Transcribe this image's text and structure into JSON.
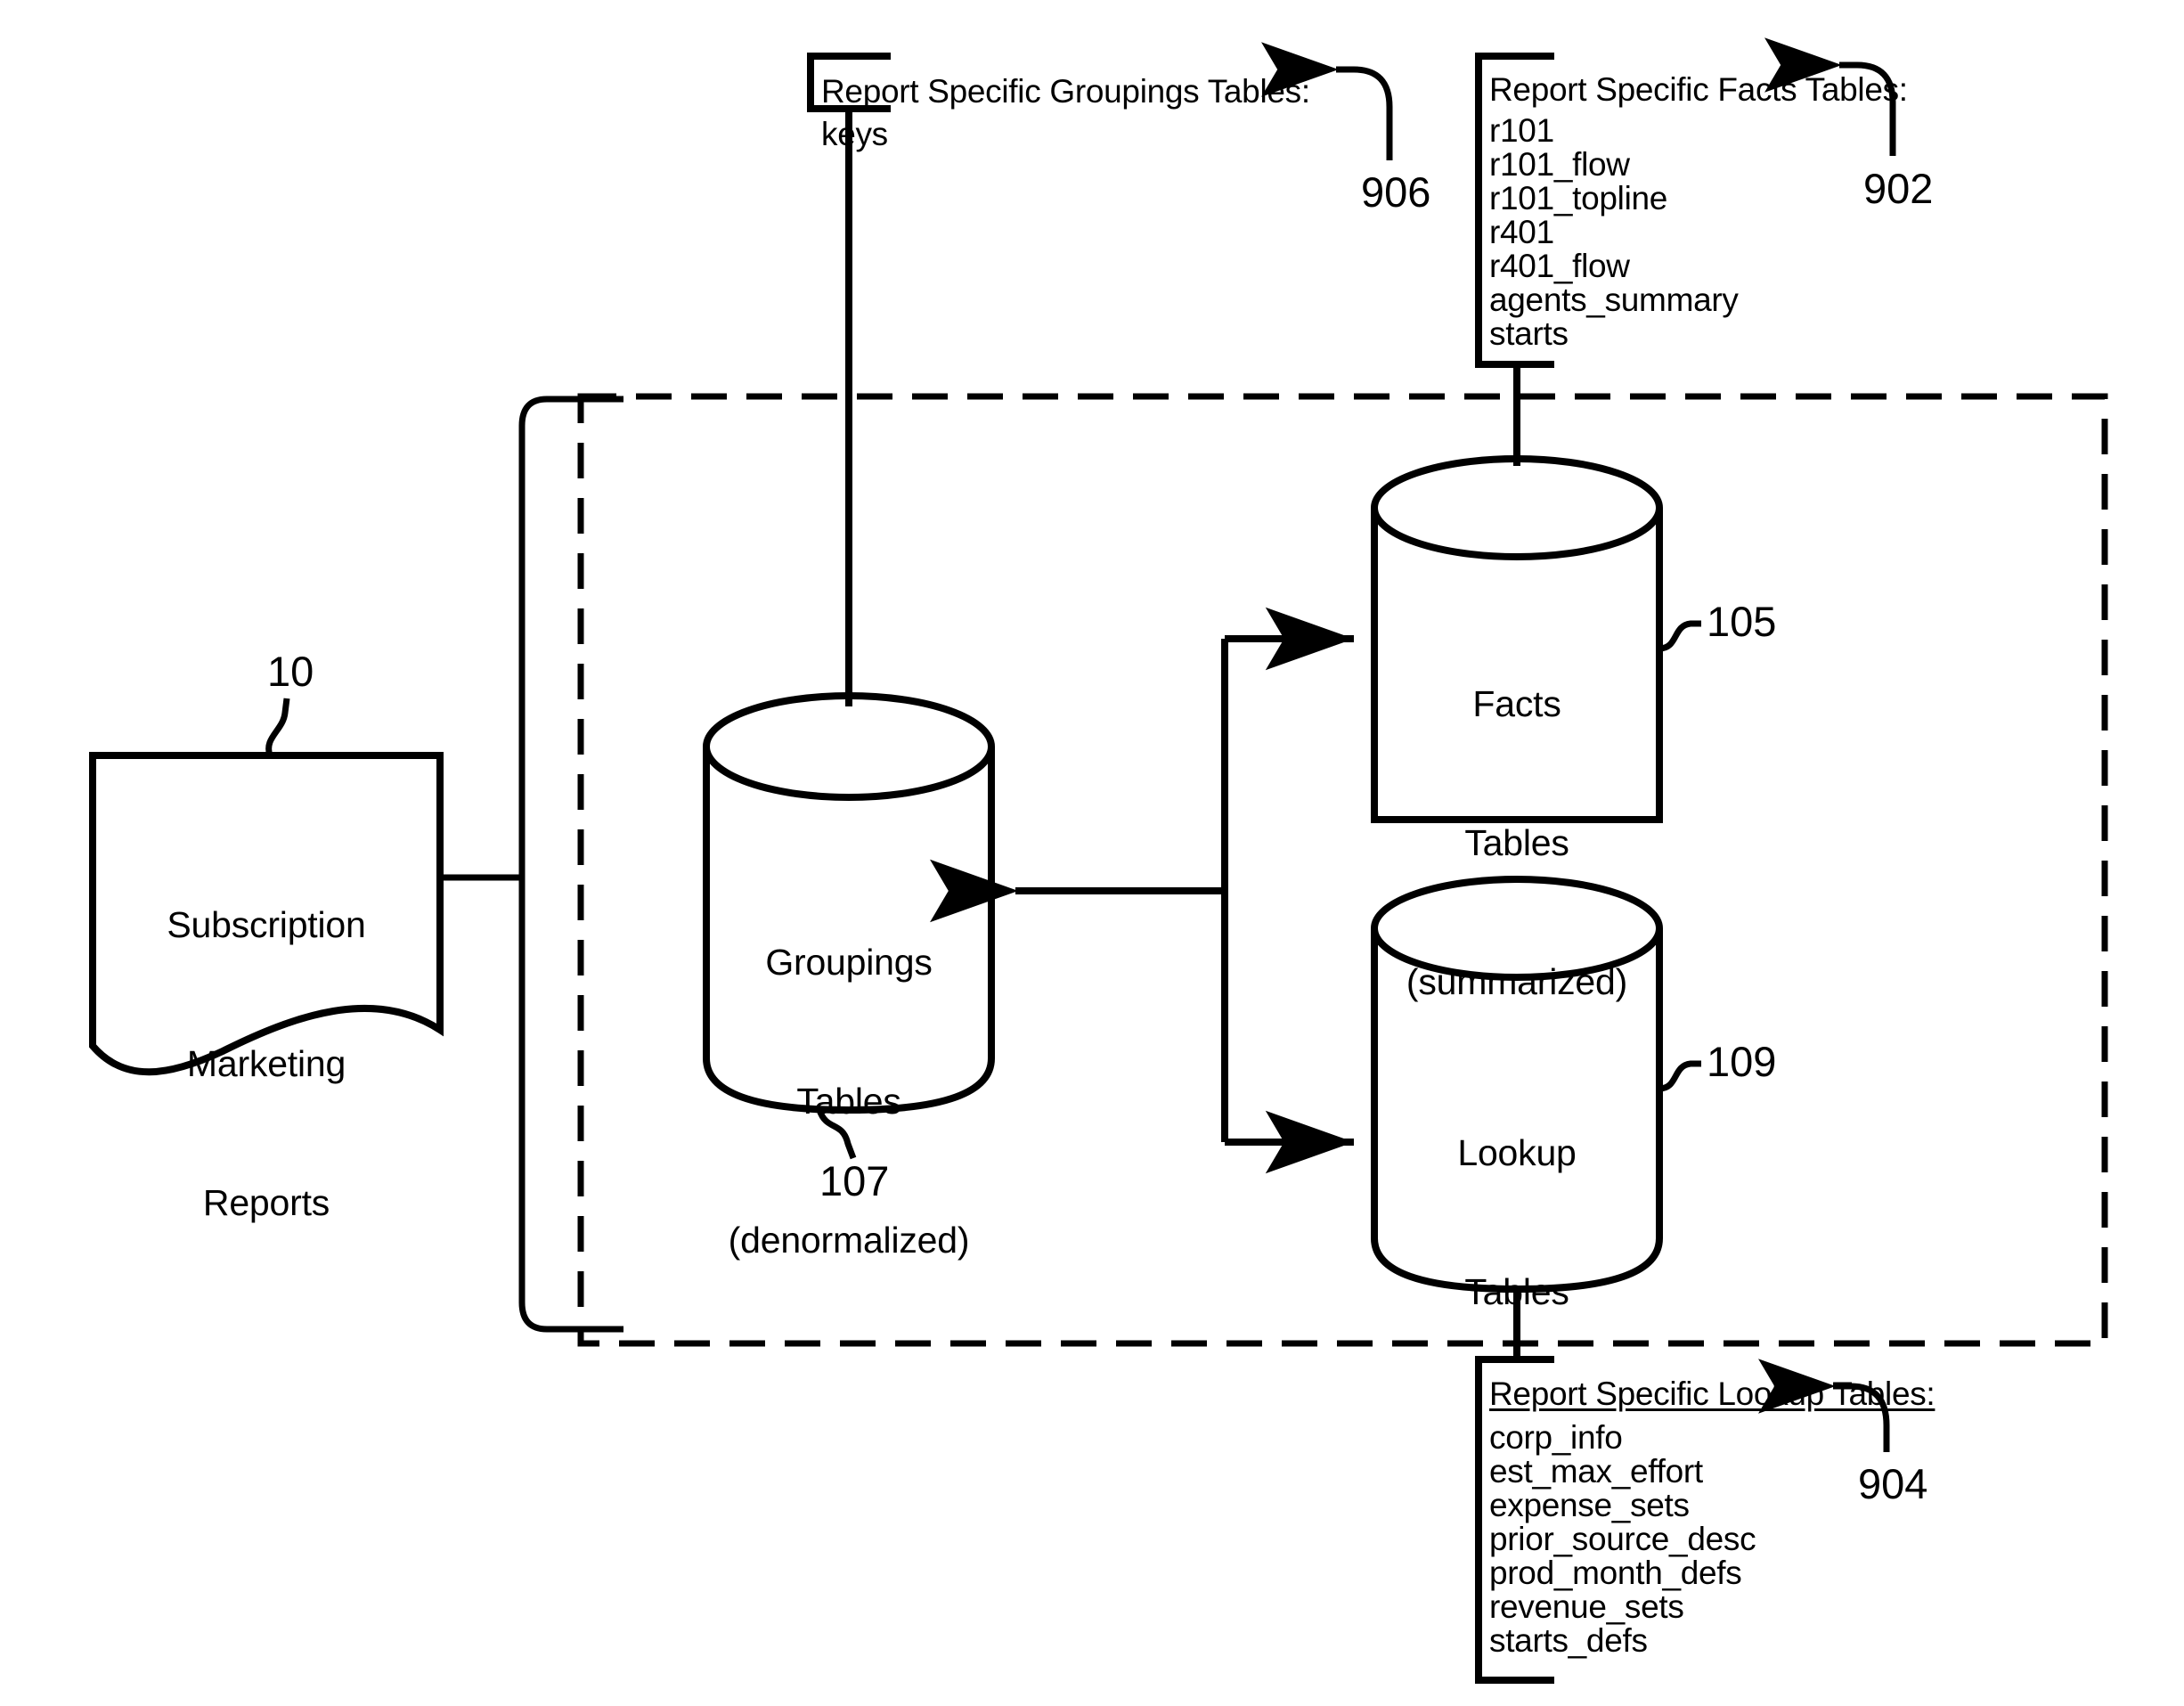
{
  "figure": {
    "type": "patent-block-diagram",
    "background": "#ffffff",
    "ink": "#000000"
  },
  "nodes": {
    "reports": {
      "name": "subscription-marketing-reports",
      "shape": "document-wavy-bottom",
      "lines": [
        "Subscription",
        "Marketing",
        "Reports"
      ],
      "ref": "10"
    },
    "groupings": {
      "name": "groupings-tables-cylinder",
      "shape": "cylinder",
      "lines": [
        "Groupings",
        "Tables",
        "(denormalized)"
      ],
      "ref": "107"
    },
    "facts": {
      "name": "facts-tables-cylinder",
      "shape": "cylinder",
      "lines": [
        "Facts",
        "Tables",
        "(summarized)"
      ],
      "ref": "105"
    },
    "lookup": {
      "name": "lookup-tables-cylinder",
      "shape": "cylinder",
      "lines": [
        "Lookup",
        "Tables"
      ],
      "ref": "109"
    }
  },
  "callouts": {
    "groupings_label": {
      "heading": "Report Specific Groupings Tables:",
      "underlined": false,
      "items": [
        "keys"
      ],
      "ref": "906"
    },
    "facts_label": {
      "heading": "Report Specific Facts Tables:",
      "underlined": false,
      "items": [
        "r101",
        "r101_flow",
        "r101_topline",
        "r401",
        "r401_flow",
        "agents_summary",
        "starts"
      ],
      "ref": "902"
    },
    "lookup_label": {
      "heading": "Report Specific Lookup Tables:",
      "underlined": true,
      "items": [
        "corp_info",
        "est_max_effort",
        "expense_sets",
        "prior_source_desc",
        "prod_month_defs",
        "revenue_sets",
        "starts_defs"
      ],
      "ref": "904"
    }
  },
  "boundary": {
    "name": "data-warehouse-dashed-boundary",
    "style": "dashed-rectangle"
  },
  "connectors": [
    {
      "name": "junction-to-facts-tables",
      "from": "junction",
      "to": "facts",
      "arrow": "right"
    },
    {
      "name": "junction-to-lookup-tables",
      "from": "junction",
      "to": "lookup",
      "arrow": "right"
    },
    {
      "name": "junction-to-groupings-tables",
      "from": "junction",
      "to": "groupings",
      "arrow": "left"
    },
    {
      "name": "bracket-to-reports",
      "from": "left-bracket",
      "to": "reports",
      "arrow": "left"
    },
    {
      "name": "groupings-label-connector",
      "from": "groupings_label",
      "to": "groupings",
      "arrow": "none"
    },
    {
      "name": "facts-label-connector",
      "from": "facts_label",
      "to": "facts",
      "arrow": "none"
    },
    {
      "name": "lookup-label-connector",
      "from": "lookup_label",
      "to": "lookup",
      "arrow": "none"
    }
  ]
}
